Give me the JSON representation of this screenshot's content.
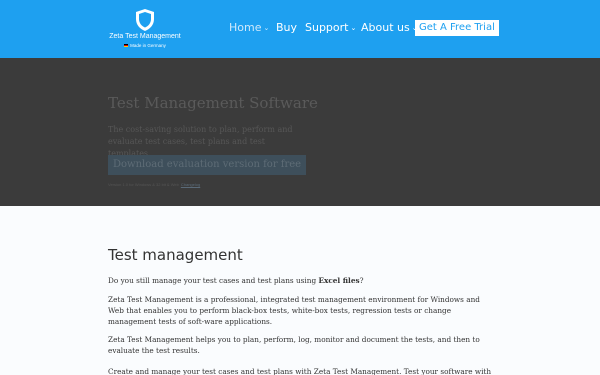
{
  "header": {
    "logo_title": "Zeta Test Management",
    "logo_subtitle": "Made in Germany",
    "nav": {
      "home": "Home",
      "buy": "Buy",
      "support": "Support",
      "about": "About us"
    },
    "cta_label": "Get A Free Trial"
  },
  "hero": {
    "title": "Test Management Software",
    "text": "The cost-saving solution to plan, perform and evaluate test cases, test plans and test templates.",
    "button_label": "Download evaluation version for free",
    "note": "Version 1.0 for Windows & 32 bit & Web",
    "note_link": "Changelog"
  },
  "main": {
    "heading": "Test management",
    "p1_before": "Do you still manage your test cases and test plans using ",
    "p1_bold": "Excel files",
    "p1_after": "?",
    "p2": "Zeta Test Management is a professional, integrated test management environment for Windows and Web that enables you to perform black-box tests, white-box tests, regression tests or change management tests of soft-ware applications.",
    "p3": "Zeta Test Management helps you to plan, perform, log, monitor and document the tests, and then to evaluate the test results.",
    "p4": "Create and manage your test cases and test plans with Zeta Test Management. Test your software with test"
  },
  "colors": {
    "header_bg": "#1ea0f0",
    "hero_overlay": "#3b3b3b",
    "cta_text": "#1ea0f0"
  },
  "icons": {
    "logo": "shield-icon",
    "dropdown": "chevron-down-icon"
  }
}
